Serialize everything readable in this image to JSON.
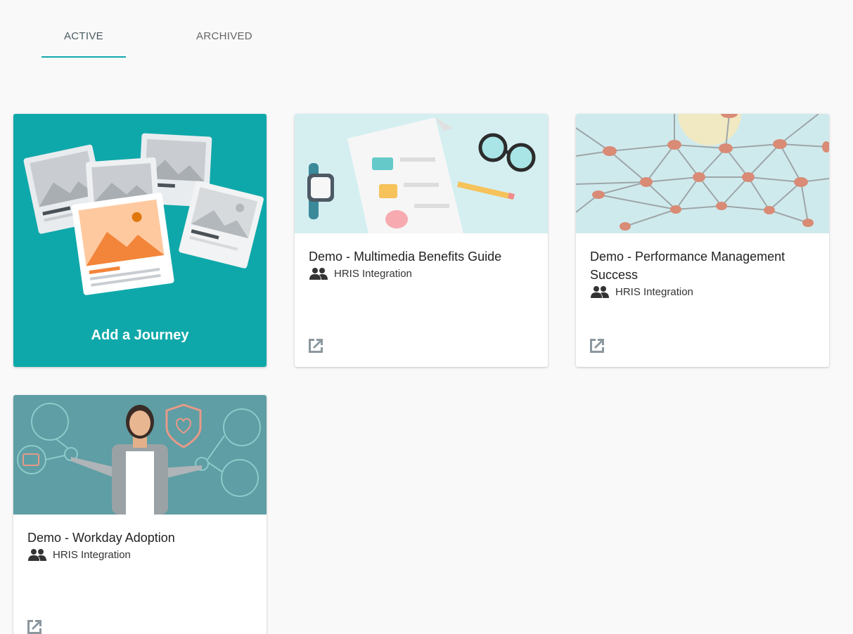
{
  "tabs": {
    "active": "ACTIVE",
    "archived": "ARCHIVED"
  },
  "add_card": {
    "label": "Add a Journey",
    "icon": "photos-illustration"
  },
  "journeys": [
    {
      "title": "Demo - Multimedia Benefits Guide",
      "audience": "HRIS Integration",
      "image": "benefits-illustration"
    },
    {
      "title": "Demo - Performance Management Success",
      "audience": "HRIS Integration",
      "image": "network-illustration"
    },
    {
      "title": "Demo - Workday Adoption",
      "audience": "HRIS Integration",
      "image": "workday-illustration"
    }
  ],
  "colors": {
    "accent": "#14a9ad",
    "add_card_bg": "#0fa8aa"
  }
}
